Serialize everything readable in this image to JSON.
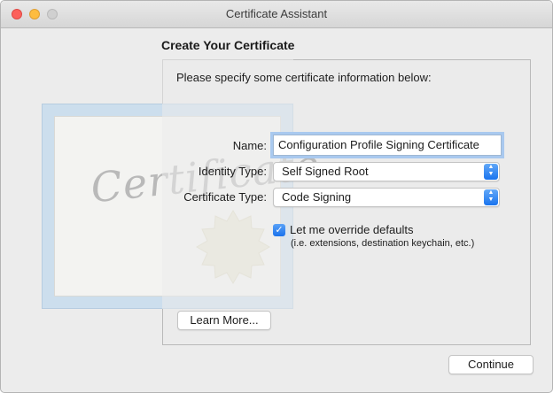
{
  "window": {
    "title": "Certificate Assistant"
  },
  "page": {
    "heading": "Create Your Certificate",
    "instructions": "Please specify some certificate information below:"
  },
  "art": {
    "word": "Certificate"
  },
  "form": {
    "name_label": "Name:",
    "name_value": "Configuration Profile Signing Certificate",
    "identity_type_label": "Identity Type:",
    "identity_type_value": "Self Signed Root",
    "certificate_type_label": "Certificate Type:",
    "certificate_type_value": "Code Signing",
    "override_checked": true,
    "override_label": "Let me override defaults",
    "override_sublabel": "(i.e. extensions, destination keychain, etc.)"
  },
  "buttons": {
    "learn_more": "Learn More...",
    "continue": "Continue"
  },
  "icons": {
    "popup": "chevron-up-down-icon",
    "check": "checkmark-icon"
  },
  "colors": {
    "accent": "#1a74ee",
    "focus_ring": "#a9c9ef"
  }
}
